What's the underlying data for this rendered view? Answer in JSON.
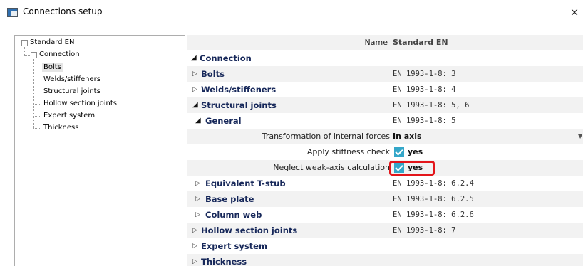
{
  "window": {
    "title": "Connections setup",
    "close_glyph": "×",
    "icon": "window-app-icon"
  },
  "tree": {
    "root": "Standard EN",
    "connection": "Connection",
    "items": [
      "Bolts",
      "Welds/stiffeners",
      "Structural joints",
      "Hollow section joints",
      "Expert system"
    ],
    "thickness": "Thickness",
    "selected": "Bolts"
  },
  "grid": {
    "name_label": "Name",
    "name_value": "Standard EN",
    "rows": [
      {
        "label": "Connection",
        "value": ""
      },
      {
        "label": "Bolts",
        "value": "EN 1993-1-8: 3"
      },
      {
        "label": "Welds/stiffeners",
        "value": "EN 1993-1-8: 4"
      },
      {
        "label": "Structural joints",
        "value": "EN 1993-1-8: 5, 6"
      },
      {
        "label": "General",
        "value": "EN 1993-1-8: 5"
      },
      {
        "label": "Transformation of internal forces",
        "value": "In axis"
      },
      {
        "label": "Apply stiffness check",
        "value": "yes"
      },
      {
        "label": "Neglect weak-axis calculation",
        "value": "yes"
      },
      {
        "label": "Equivalent T-stub",
        "value": "EN 1993-1-8: 6.2.4"
      },
      {
        "label": "Base plate",
        "value": "EN 1993-1-8: 6.2.5"
      },
      {
        "label": "Column web",
        "value": "EN 1993-1-8: 6.2.6"
      },
      {
        "label": "Hollow section joints",
        "value": "EN 1993-1-8: 7"
      },
      {
        "label": "Expert system",
        "value": ""
      },
      {
        "label": "Thickness",
        "value": ""
      }
    ],
    "expand_glyph": "▷",
    "collapse_glyph": "◢",
    "dropdown_glyph": "▼"
  },
  "colors": {
    "accent_check": "#34a7c9",
    "highlight": "#e3151a",
    "section_text": "#17285a"
  }
}
